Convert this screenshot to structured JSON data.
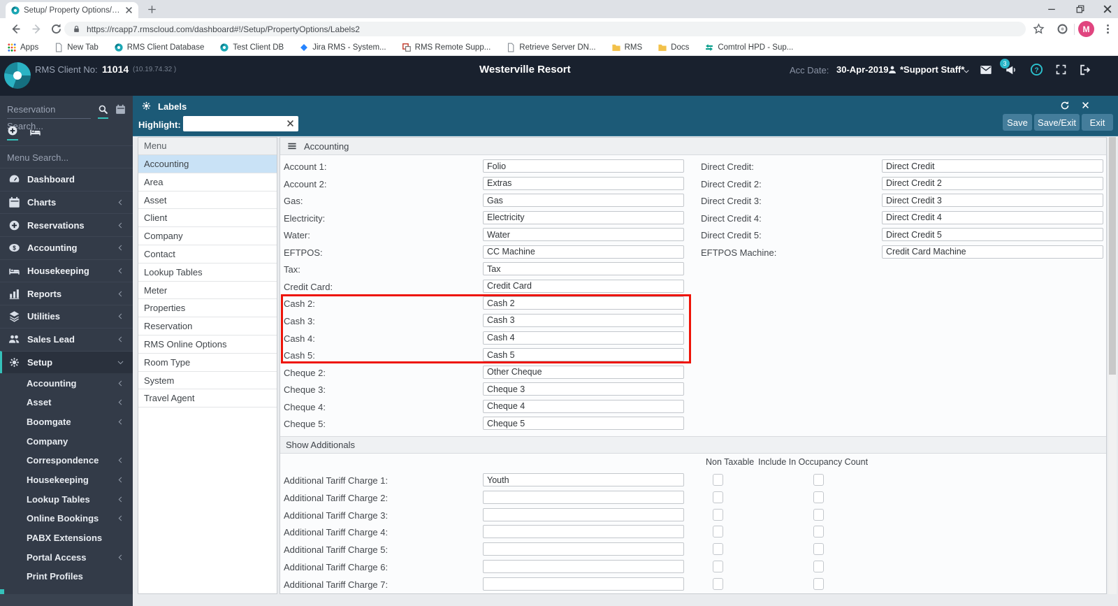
{
  "browser": {
    "tab_title": "Setup/ Property Options/ Labels2",
    "url": "https://rcapp7.rmscloud.com/dashboard#!/Setup/PropertyOptions/Labels2",
    "avatar_letter": "M",
    "bookmarks": [
      {
        "label": "Apps",
        "icon": "apps-grid"
      },
      {
        "label": "New Tab",
        "icon": "page"
      },
      {
        "label": "RMS Client Database",
        "icon": "rms-circle"
      },
      {
        "label": "Test Client DB",
        "icon": "rms-circle"
      },
      {
        "label": "Jira RMS - System...",
        "icon": "jira-diamond"
      },
      {
        "label": "RMS Remote Supp...",
        "icon": "remote-red"
      },
      {
        "label": "Retrieve Server DN...",
        "icon": "page"
      },
      {
        "label": "RMS",
        "icon": "folder"
      },
      {
        "label": "Docs",
        "icon": "folder"
      },
      {
        "label": "Comtrol HPD - Sup...",
        "icon": "comtrol"
      }
    ]
  },
  "header": {
    "client_no_label": "RMS Client No:",
    "client_no": "11014",
    "client_ip": "(10.19.74.32 )",
    "property_name": "Westerville Resort",
    "acc_date_label": "Acc Date:",
    "acc_date": "30-Apr-2019",
    "user_name": "*Support Staff*",
    "notification_count": "3",
    "toolbar_icons": [
      "menu",
      "plus-circle",
      "search",
      "card",
      "speedometer",
      "person",
      "book",
      "map",
      "calendar-b",
      "calendar-a",
      "calendar-r",
      "calendar-check",
      "coin",
      "document",
      "cart",
      "dollar",
      "quote",
      "bed",
      "wrench",
      "swap"
    ]
  },
  "sidebar": {
    "reservation_search_placeholder": "Reservation Search...",
    "menu_search_placeholder": "Menu Search...",
    "items": [
      {
        "label": "Dashboard",
        "icon": "speedometer",
        "chevron": ""
      },
      {
        "label": "Charts",
        "icon": "calendar-plain",
        "chevron": "left"
      },
      {
        "label": "Reservations",
        "icon": "plus-circle",
        "chevron": "left"
      },
      {
        "label": "Accounting",
        "icon": "coin",
        "chevron": "left"
      },
      {
        "label": "Housekeeping",
        "icon": "bed",
        "chevron": "left"
      },
      {
        "label": "Reports",
        "icon": "chart-bars",
        "chevron": "left"
      },
      {
        "label": "Utilities",
        "icon": "layers",
        "chevron": "left"
      },
      {
        "label": "Sales Lead",
        "icon": "people",
        "chevron": "left"
      },
      {
        "label": "Setup",
        "icon": "gears",
        "chevron": "down",
        "active": true
      }
    ],
    "setup_subitems": [
      {
        "label": "Accounting",
        "chevron": "left"
      },
      {
        "label": "Asset",
        "chevron": "left"
      },
      {
        "label": "Boomgate",
        "chevron": "left"
      },
      {
        "label": "Company",
        "chevron": ""
      },
      {
        "label": "Correspondence",
        "chevron": "left"
      },
      {
        "label": "Housekeeping",
        "chevron": "left"
      },
      {
        "label": "Lookup Tables",
        "chevron": "left"
      },
      {
        "label": "Online Bookings",
        "chevron": "left"
      },
      {
        "label": "PABX Extensions",
        "chevron": ""
      },
      {
        "label": "Portal Access",
        "chevron": "left"
      },
      {
        "label": "Print Profiles",
        "chevron": ""
      }
    ]
  },
  "panel": {
    "title": "Labels",
    "highlight_label": "Highlight:",
    "highlight_value": "",
    "save_label": "Save",
    "save_exit_label": "Save/Exit",
    "exit_label": "Exit"
  },
  "menu_list": {
    "header": "Menu",
    "selected": "Accounting",
    "items": [
      "Accounting",
      "Area",
      "Asset",
      "Client",
      "Company",
      "Contact",
      "Lookup Tables",
      "Meter",
      "Properties",
      "Reservation",
      "RMS Online Options",
      "Room Type",
      "System",
      "Travel Agent"
    ]
  },
  "form": {
    "section_title": "Accounting",
    "left_rows": [
      {
        "label": "Account 1:",
        "value": "Folio"
      },
      {
        "label": "Account 2:",
        "value": "Extras"
      },
      {
        "label": "Gas:",
        "value": "Gas"
      },
      {
        "label": "Electricity:",
        "value": "Electricity"
      },
      {
        "label": "Water:",
        "value": "Water"
      },
      {
        "label": "EFTPOS:",
        "value": "CC Machine"
      },
      {
        "label": "Tax:",
        "value": "Tax"
      },
      {
        "label": "Credit Card:",
        "value": "Credit Card"
      },
      {
        "label": "Cash 2:",
        "value": "Cash 2"
      },
      {
        "label": "Cash 3:",
        "value": "Cash 3"
      },
      {
        "label": "Cash 4:",
        "value": "Cash 4"
      },
      {
        "label": "Cash 5:",
        "value": "Cash 5"
      },
      {
        "label": "Cheque 2:",
        "value": "Other Cheque"
      },
      {
        "label": "Cheque 3:",
        "value": "Cheque 3"
      },
      {
        "label": "Cheque 4:",
        "value": "Cheque 4"
      },
      {
        "label": "Cheque 5:",
        "value": "Cheque 5"
      }
    ],
    "right_rows": [
      {
        "label": "Direct Credit:",
        "value": "Direct Credit"
      },
      {
        "label": "Direct Credit 2:",
        "value": "Direct Credit 2"
      },
      {
        "label": "Direct Credit 3:",
        "value": "Direct Credit 3"
      },
      {
        "label": "Direct Credit 4:",
        "value": "Direct Credit 4"
      },
      {
        "label": "Direct Credit 5:",
        "value": "Direct Credit 5"
      },
      {
        "label": "EFTPOS Machine:",
        "value": "Credit Card Machine"
      }
    ],
    "show_additionals_label": "Show Additionals",
    "col_non_taxable": "Non Taxable",
    "col_occupancy": "Include In Occupancy Count",
    "additional_rows": [
      {
        "label": "Additional Tariff Charge 1:",
        "value": "Youth",
        "non_taxable": false,
        "occupancy": false
      },
      {
        "label": "Additional Tariff Charge 2:",
        "value": "",
        "non_taxable": false,
        "occupancy": false
      },
      {
        "label": "Additional Tariff Charge 3:",
        "value": "",
        "non_taxable": false,
        "occupancy": false
      },
      {
        "label": "Additional Tariff Charge 4:",
        "value": "",
        "non_taxable": false,
        "occupancy": false
      },
      {
        "label": "Additional Tariff Charge 5:",
        "value": "",
        "non_taxable": false,
        "occupancy": false
      },
      {
        "label": "Additional Tariff Charge 6:",
        "value": "",
        "non_taxable": false,
        "occupancy": false
      },
      {
        "label": "Additional Tariff Charge 7:",
        "value": "",
        "non_taxable": false,
        "occupancy": false
      }
    ]
  },
  "colors": {
    "header_bg": "#19212e",
    "sidebar_bg": "#333b48",
    "panel_teal": "#1c5a77",
    "button_blue": "#447d9b",
    "accent_teal": "#35c1ba",
    "selected_row_blue": "#c9e2f6",
    "highlight_red": "#ee1408",
    "badge_teal": "#29b6c8",
    "avatar_pink": "#e0457f"
  }
}
